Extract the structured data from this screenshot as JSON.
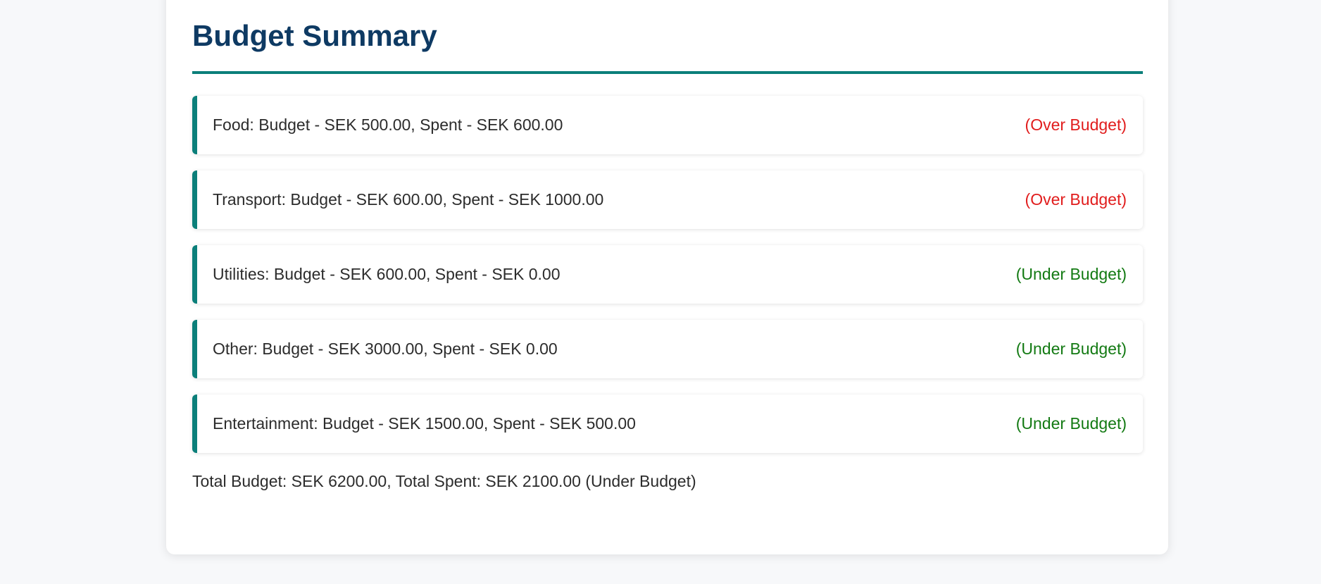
{
  "page": {
    "title": "Budget Summary"
  },
  "colors": {
    "title": "#0e3a63",
    "accent": "#0b7f7a",
    "over_budget": "#e11d1d",
    "under_budget": "#137a13",
    "background": "#f7f8fa",
    "card": "#ffffff"
  },
  "items": [
    {
      "text": "Food: Budget - SEK 500.00, Spent - SEK 600.00",
      "status": "(Over Budget)",
      "state": "over"
    },
    {
      "text": "Transport: Budget - SEK 600.00, Spent - SEK 1000.00",
      "status": "(Over Budget)",
      "state": "over"
    },
    {
      "text": "Utilities: Budget - SEK 600.00, Spent - SEK 0.00",
      "status": "(Under Budget)",
      "state": "under"
    },
    {
      "text": "Other: Budget - SEK 3000.00, Spent - SEK 0.00",
      "status": "(Under Budget)",
      "state": "under"
    },
    {
      "text": "Entertainment: Budget - SEK 1500.00, Spent - SEK 500.00",
      "status": "(Under Budget)",
      "state": "under"
    }
  ],
  "total": {
    "text": "Total Budget: SEK 6200.00, Total Spent: SEK 2100.00 (Under Budget)"
  }
}
